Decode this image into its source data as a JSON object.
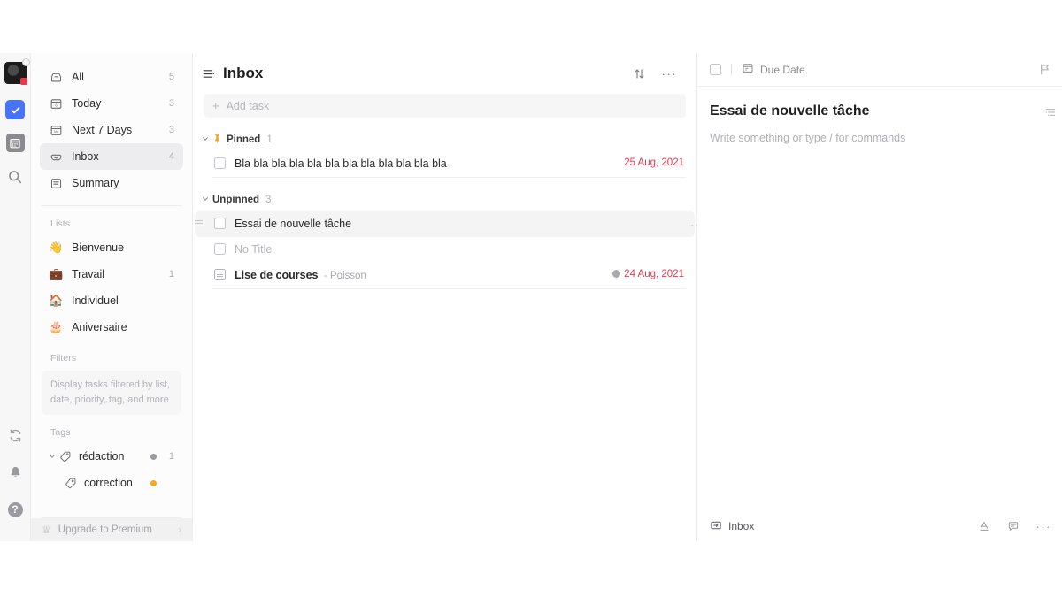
{
  "rail": {
    "avatar": {
      "name": "user-avatar",
      "emoji": "🐈‍⬛",
      "badge_color": "#e8384f"
    },
    "items": [
      {
        "name": "tasks-app-icon",
        "label": "Tasks",
        "glyph": "check",
        "active": true,
        "color": "#4772fa"
      },
      {
        "name": "calendar-app-icon",
        "label": "Calendar",
        "glyph": "calendar",
        "active": false
      },
      {
        "name": "search-icon",
        "label": "Search",
        "glyph": "search",
        "active": false
      }
    ],
    "bottom_items": [
      {
        "name": "sync-icon",
        "label": "Sync"
      },
      {
        "name": "notification-bell-icon",
        "label": "Notifications"
      },
      {
        "name": "help-icon",
        "label": "Help",
        "glyph": "?"
      }
    ]
  },
  "sidebar": {
    "smart_lists": [
      {
        "label": "All",
        "count": "5",
        "icon": "inbox-tray-icon",
        "active": false
      },
      {
        "label": "Today",
        "count": "3",
        "icon": "calendar-day-icon",
        "active": false
      },
      {
        "label": "Next 7 Days",
        "count": "3",
        "icon": "calendar-week-icon",
        "active": false
      },
      {
        "label": "Inbox",
        "count": "4",
        "icon": "inbox-icon",
        "active": true
      },
      {
        "label": "Summary",
        "count": "",
        "icon": "summary-icon",
        "active": false
      }
    ],
    "lists_section_title": "Lists",
    "lists": [
      {
        "label": "Bienvenue",
        "emoji": "👋",
        "count": ""
      },
      {
        "label": "Travail",
        "emoji": "💼",
        "count": "1"
      },
      {
        "label": "Individuel",
        "emoji": "🏠",
        "count": ""
      },
      {
        "label": "Aniversaire",
        "emoji": "🎂",
        "count": ""
      }
    ],
    "filters_section_title": "Filters",
    "filters_empty_text": "Display tasks filtered by list, date, priority, tag, and more",
    "tags_section_title": "Tags",
    "tags": [
      {
        "label": "rédaction",
        "dot_color": "#9a9a9f",
        "count": "1",
        "expanded": true,
        "sub": false
      },
      {
        "label": "correction",
        "dot_color": "#f5a623",
        "count": "",
        "expanded": false,
        "sub": true
      }
    ],
    "premium": {
      "label": "Upgrade to Premium",
      "crown": "♕",
      "chevron": "›"
    }
  },
  "list_pane": {
    "title": "Inbox",
    "menu_icon": "list-menu-icon",
    "sort_icon": "sort-icon",
    "more_icon": "more-options-icon",
    "add_task_placeholder": "Add task",
    "groups": [
      {
        "name": "pinned",
        "label": "Pinned",
        "count": "1",
        "pin_icon": "pin-icon",
        "tasks": [
          {
            "title": "Bla bla bla bla bla bla bla bla bla bla bla bla",
            "date": "25 Aug, 2021",
            "has_clock": false,
            "selected": false,
            "style": "normal",
            "subtitle": "",
            "icon": "checkbox"
          }
        ]
      },
      {
        "name": "unpinned",
        "label": "Unpinned",
        "count": "3",
        "pin_icon": "",
        "tasks": [
          {
            "title": "Essai de nouvelle tâche",
            "date": "",
            "has_clock": false,
            "selected": true,
            "style": "normal",
            "subtitle": "",
            "icon": "checkbox"
          },
          {
            "title": "No Title",
            "date": "",
            "has_clock": false,
            "selected": false,
            "style": "muted",
            "subtitle": "",
            "icon": "checkbox"
          },
          {
            "title": "Lise de courses",
            "date": "24 Aug, 2021",
            "has_clock": true,
            "selected": false,
            "style": "strong",
            "subtitle": "- Poisson",
            "icon": "note"
          }
        ]
      }
    ]
  },
  "detail": {
    "checkbox_name": "task-complete-checkbox",
    "due_date_label": "Due Date",
    "due_date_icon": "calendar-icon",
    "flag_icon": "priority-flag-icon",
    "title": "Essai de nouvelle tâche",
    "content_placeholder": "Write something or type / for commands",
    "outline_icon": "outline-icon",
    "footer": {
      "location_label": "Inbox",
      "location_icon": "move-to-list-icon",
      "icons": [
        {
          "name": "text-format-icon",
          "glyph": "A"
        },
        {
          "name": "comment-icon",
          "glyph": "comment"
        },
        {
          "name": "more-options-icon",
          "glyph": "dots"
        }
      ]
    }
  }
}
